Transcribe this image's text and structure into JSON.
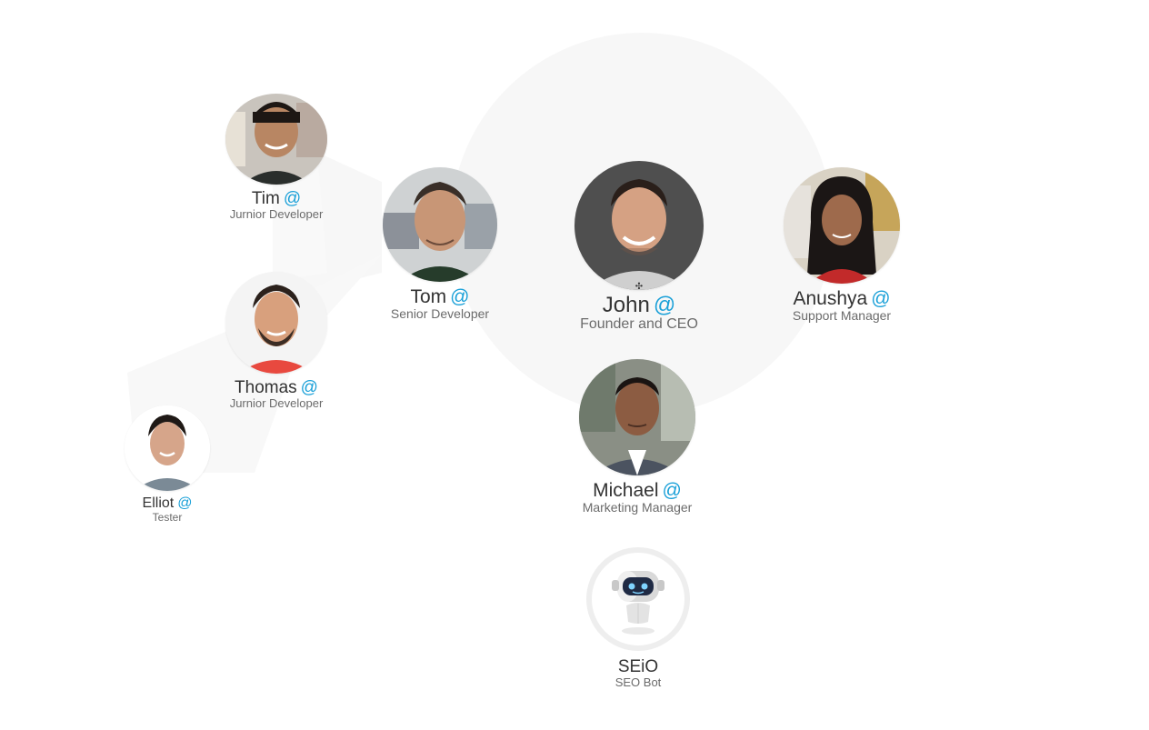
{
  "colors": {
    "accent": "#1aa0d8",
    "name_text": "#333333",
    "role_text": "#6b6b6b",
    "halo": "#f7f7f7"
  },
  "members": {
    "tim": {
      "name": "Tim",
      "role": "Jurnior Developer",
      "at": "@"
    },
    "tom": {
      "name": "Tom",
      "role": "Senior Developer",
      "at": "@"
    },
    "john": {
      "name": "John",
      "role": "Founder and CEO",
      "at": "@"
    },
    "anushya": {
      "name": "Anushya",
      "role": "Support Manager",
      "at": "@"
    },
    "thomas": {
      "name": "Thomas",
      "role": "Jurnior Developer",
      "at": "@"
    },
    "elliot": {
      "name": "Elliot",
      "role": "Tester",
      "at": "@"
    },
    "michael": {
      "name": "Michael",
      "role": "Marketing Manager",
      "at": "@"
    },
    "seio": {
      "name": "SEiO",
      "role": "SEO Bot"
    }
  },
  "icons": {
    "mention": "at-icon",
    "move": "move-crosshair-icon",
    "bot": "robot-icon"
  },
  "move_glyph": "✣"
}
